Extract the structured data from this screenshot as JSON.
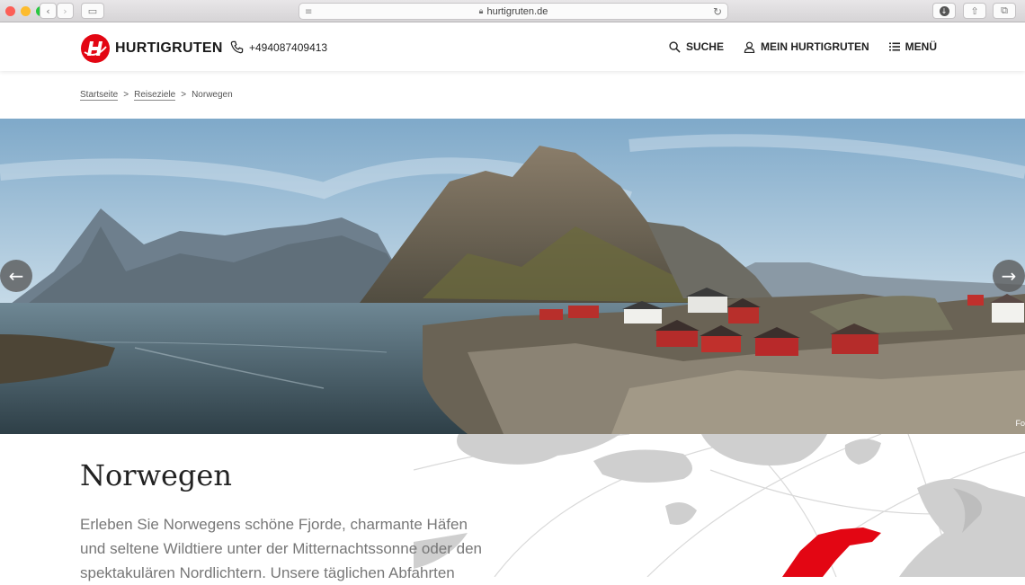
{
  "browser": {
    "url": "hurtigruten.de"
  },
  "header": {
    "logo_text": "HURTIGRUTEN",
    "phone": "+494087409413",
    "nav": {
      "search": "SUCHE",
      "account": "MEIN HURTIGRUTEN",
      "menu": "MENÜ"
    }
  },
  "breadcrumb": {
    "home": "Startseite",
    "sep1": ">",
    "destinations": "Reiseziele",
    "sep2": ">",
    "current": "Norwegen"
  },
  "hero": {
    "prev_arrow": "←",
    "next_arrow": "→",
    "credit": "Fo"
  },
  "content": {
    "title": "Norwegen",
    "intro": "Erleben Sie Norwegens schöne Fjorde, charmante Häfen und seltene Wildtiere unter der Mitternachtssonne oder den spektakulären Nordlichtern. Unsere täglichen Abfahrten"
  },
  "colors": {
    "brand_red": "#e30613",
    "map_gray": "#cfcfcf"
  }
}
